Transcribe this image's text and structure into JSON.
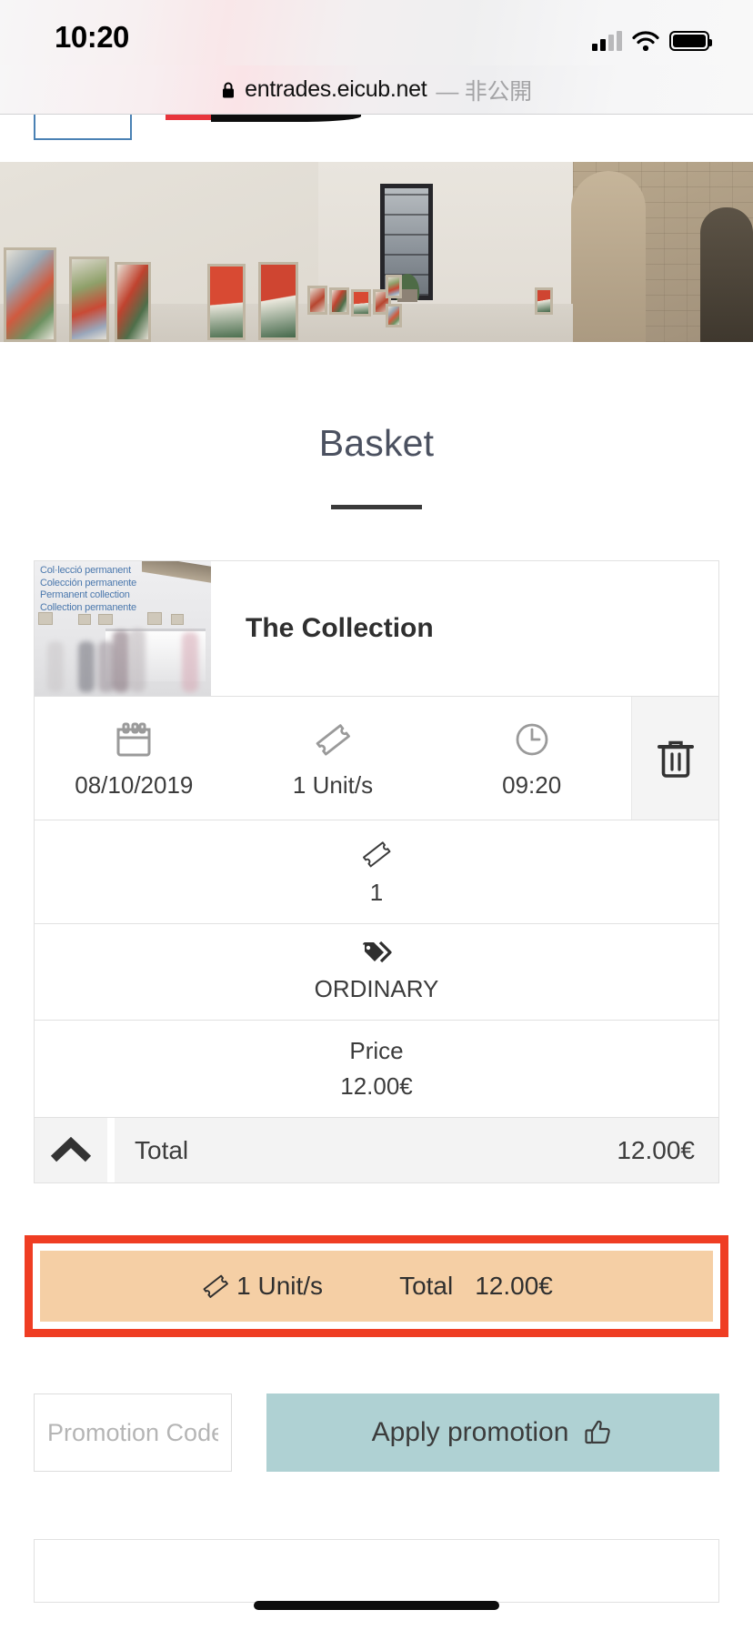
{
  "status_bar": {
    "time": "10:20",
    "icons": [
      "cellular-signal-icon",
      "wifi-icon",
      "battery-icon"
    ]
  },
  "browser": {
    "lock_icon": "lock-icon",
    "url": "entrades.eicub.net",
    "private_label": "— 非公開"
  },
  "hero": {
    "alt": "museum-gallery-hero-image"
  },
  "basket": {
    "title": "Basket",
    "product": {
      "name": "The Collection",
      "thumbnail_captions": [
        "Col·lecció permanent",
        "Colección permanente",
        "Permanent collection",
        "Collection permanente"
      ]
    },
    "details": [
      {
        "icon": "calendar-icon",
        "value": "08/10/2019"
      },
      {
        "icon": "ticket-icon",
        "value": "1 Unit/s"
      },
      {
        "icon": "clock-icon",
        "value": "09:20"
      }
    ],
    "delete_icon": "trash-icon",
    "quantity_row": {
      "icon": "ticket-icon",
      "value": "1"
    },
    "rate_row": {
      "icon": "tag-icon",
      "value": "ORDINARY"
    },
    "price_row": {
      "label": "Price",
      "value": "12.00€"
    },
    "total_row": {
      "collapse_icon": "chevron-up-icon",
      "label": "Total",
      "value": "12.00€"
    }
  },
  "summary_bar": {
    "ticket_icon": "ticket-icon",
    "units": "1 Unit/s",
    "total_label": "Total",
    "total_value": "12.00€",
    "highlight_color": "#ef3d23",
    "background_color": "#f5cfa5"
  },
  "promotion": {
    "input_placeholder": "Promotion Code",
    "input_value": "",
    "button_label": "Apply promotion",
    "button_icon": "thumbs-up-icon",
    "button_color": "#afd1d3"
  },
  "colors": {
    "title": "#4b5160",
    "text": "#3c3c3c",
    "border": "#e1e1e1"
  }
}
